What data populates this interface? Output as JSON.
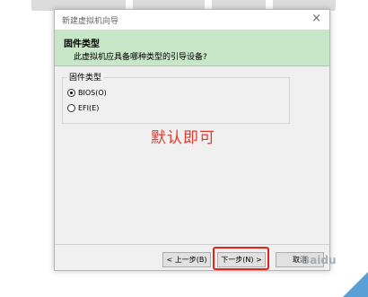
{
  "window": {
    "title": "新建虚拟机向导",
    "close_glyph": "×"
  },
  "header": {
    "title": "固件类型",
    "description": "此虚拟机应具备哪种类型的引导设备?"
  },
  "firmware_group": {
    "label": "固件类型",
    "options": [
      {
        "label": "BIOS(O)",
        "checked": true
      },
      {
        "label": "EFI(E)",
        "checked": false
      }
    ]
  },
  "annotation": "默认即可",
  "buttons": {
    "back": "< 上一步(B)",
    "next": "下一步(N) >",
    "cancel": "取消"
  },
  "watermark": "Baidu"
}
